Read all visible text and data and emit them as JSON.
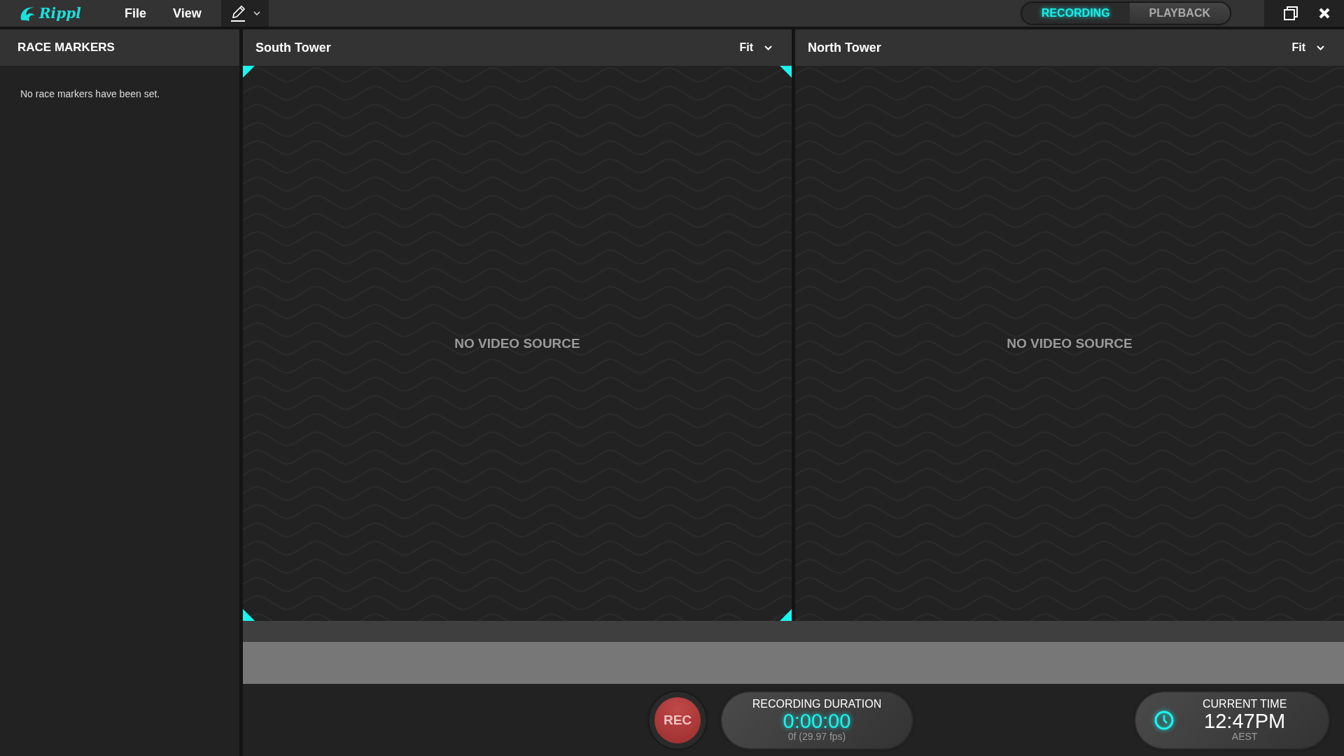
{
  "app": {
    "logo": "Rippl"
  },
  "menu": [
    {
      "label": "File"
    },
    {
      "label": "View"
    }
  ],
  "mode_toggle": [
    {
      "label": "RECORDING",
      "selected": true
    },
    {
      "label": "PLAYBACK",
      "selected": false
    }
  ],
  "sidebar": {
    "title": "RACE MARKERS",
    "empty_message": "No race markers have been set."
  },
  "views": [
    {
      "title": "South Tower",
      "scale": "Fit",
      "message": "NO VIDEO SOURCE",
      "selected": true
    },
    {
      "title": "North Tower",
      "scale": "Fit",
      "message": "NO VIDEO SOURCE",
      "selected": false
    }
  ],
  "rec_button": {
    "label": "REC",
    "on": false
  },
  "recording_duration": {
    "title": "RECORDING DURATION",
    "value": "0:00:00",
    "frames": "0f (29.97 fps)"
  },
  "current_time": {
    "title": "CURRENT TIME",
    "value": "12:47PM",
    "zone": "AEST"
  }
}
